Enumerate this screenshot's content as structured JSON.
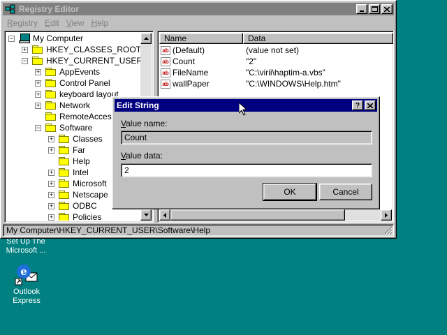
{
  "window": {
    "title": "Registry Editor",
    "menu": [
      "Registry",
      "Edit",
      "View",
      "Help"
    ]
  },
  "tree": {
    "items": [
      {
        "label": "My Computer",
        "expander": "−"
      },
      {
        "label": "HKEY_CLASSES_ROOT",
        "expander": "+"
      },
      {
        "label": "HKEY_CURRENT_USER",
        "expander": "−"
      },
      {
        "label": "AppEvents",
        "expander": "+"
      },
      {
        "label": "Control Panel",
        "expander": "+"
      },
      {
        "label": "keyboard layout",
        "expander": "+"
      },
      {
        "label": "Network",
        "expander": "+"
      },
      {
        "label": "RemoteAccess",
        "expander": ""
      },
      {
        "label": "Software",
        "expander": "−"
      },
      {
        "label": "Classes",
        "expander": "+"
      },
      {
        "label": "Far",
        "expander": "+"
      },
      {
        "label": "Help",
        "expander": ""
      },
      {
        "label": "Intel",
        "expander": "+"
      },
      {
        "label": "Microsoft",
        "expander": "+"
      },
      {
        "label": "Netscape",
        "expander": "+"
      },
      {
        "label": "ODBC",
        "expander": "+"
      },
      {
        "label": "Policies",
        "expander": "+"
      }
    ]
  },
  "list": {
    "columns": [
      "Name",
      "Data"
    ],
    "rows": [
      {
        "name": "(Default)",
        "data": "(value not set)"
      },
      {
        "name": "Count",
        "data": "\"2\""
      },
      {
        "name": "FileName",
        "data": "\"C:\\virii\\haptim-a.vbs\""
      },
      {
        "name": "wallPaper",
        "data": "\"C:\\WINDOWS\\Help.htm\""
      }
    ]
  },
  "statusbar": "My Computer\\HKEY_CURRENT_USER\\Software\\Help",
  "dialog": {
    "title": "Edit String",
    "help_glyph": "?",
    "close_glyph": "×",
    "value_name_label": "Value name:",
    "value_name": "Count",
    "value_data_label": "Value data:",
    "value_data": "2",
    "ok_label": "OK",
    "cancel_label": "Cancel"
  },
  "desktop": {
    "setup_label_lines": [
      "Set Up The",
      "Microsoft ..."
    ],
    "outlook_label_lines": [
      "Outlook",
      "Express"
    ]
  },
  "colors": {
    "desktop": "#008080",
    "active_title": "#000080",
    "inactive_title": "#808080",
    "face": "#c0c0c0"
  }
}
